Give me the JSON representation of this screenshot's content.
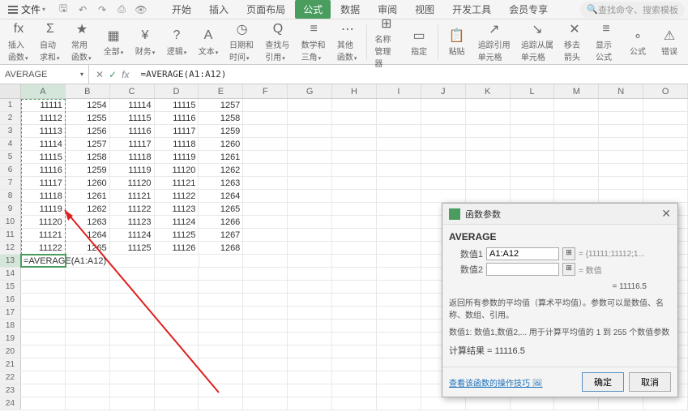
{
  "menubar": {
    "file": "文件"
  },
  "tabs": [
    "开始",
    "插入",
    "页面布局",
    "公式",
    "数据",
    "审阅",
    "视图",
    "开发工具",
    "会员专享"
  ],
  "active_tab": 3,
  "search_placeholder": "查找命令、搜索模板",
  "ribbon": [
    {
      "label": "插入函数",
      "icon": "fx"
    },
    {
      "label": "自动求和",
      "icon": "Σ"
    },
    {
      "label": "常用函数",
      "icon": "★"
    },
    {
      "label": "全部",
      "icon": "▦"
    },
    {
      "label": "财务",
      "icon": "¥"
    },
    {
      "label": "逻辑",
      "icon": "?"
    },
    {
      "label": "文本",
      "icon": "A"
    },
    {
      "label": "日期和时间",
      "icon": "◷"
    },
    {
      "label": "查找与引用",
      "icon": "Q"
    },
    {
      "label": "数学和三角",
      "icon": "≡"
    },
    {
      "label": "其他函数",
      "icon": "⋯"
    }
  ],
  "ribbon2": [
    {
      "label": "名称管理器",
      "icon": "⊞"
    },
    {
      "label": "指定",
      "icon": "▭"
    },
    {
      "label": "粘贴",
      "icon": "📋"
    },
    {
      "label": "追踪引用单元格",
      "icon": "↗"
    },
    {
      "label": "追踪从属单元格",
      "icon": "↘"
    },
    {
      "label": "移去箭头",
      "icon": "✕"
    },
    {
      "label": "显示公式",
      "icon": "≡"
    },
    {
      "label": "公式",
      "icon": "∘"
    },
    {
      "label": "错误",
      "icon": "⚠"
    }
  ],
  "name_box": "AVERAGE",
  "formula": "=AVERAGE(A1:A12)",
  "columns": [
    "A",
    "B",
    "C",
    "D",
    "E",
    "F",
    "G",
    "H",
    "I",
    "J",
    "K",
    "L",
    "M",
    "N",
    "O"
  ],
  "grid": [
    [
      "11111",
      "1254",
      "11114",
      "11115",
      "1257"
    ],
    [
      "11112",
      "1255",
      "11115",
      "11116",
      "1258"
    ],
    [
      "11113",
      "1256",
      "11116",
      "11117",
      "1259"
    ],
    [
      "11114",
      "1257",
      "11117",
      "11118",
      "1260"
    ],
    [
      "11115",
      "1258",
      "11118",
      "11119",
      "1261"
    ],
    [
      "11116",
      "1259",
      "11119",
      "11120",
      "1262"
    ],
    [
      "11117",
      "1260",
      "11120",
      "11121",
      "1263"
    ],
    [
      "11118",
      "1261",
      "11121",
      "11122",
      "1264"
    ],
    [
      "11119",
      "1262",
      "11122",
      "11123",
      "1265"
    ],
    [
      "11120",
      "1263",
      "11123",
      "11124",
      "1266"
    ],
    [
      "11121",
      "1264",
      "11124",
      "11125",
      "1267"
    ],
    [
      "11122",
      "1265",
      "11125",
      "11126",
      "1268"
    ]
  ],
  "active_cell_text": "=AVERAGE(A1:A12)",
  "dialog": {
    "title": "函数参数",
    "fn": "AVERAGE",
    "arg1_label": "数值1",
    "arg1_value": "A1:A12",
    "arg1_hint": "= {11111;11112;1...",
    "arg2_label": "数值2",
    "arg2_value": "",
    "arg2_hint": "= 数值",
    "preview": "= 11116.5",
    "desc1": "返回所有参数的平均值（算术平均值）。参数可以是数值、名称、数组、引用。",
    "desc2": "数值1: 数值1,数值2,... 用于计算平均值的 1 到 255 个数值参数",
    "result_label": "计算结果 = 11116.5",
    "link": "查看该函数的操作技巧",
    "ok": "确定",
    "cancel": "取消"
  }
}
